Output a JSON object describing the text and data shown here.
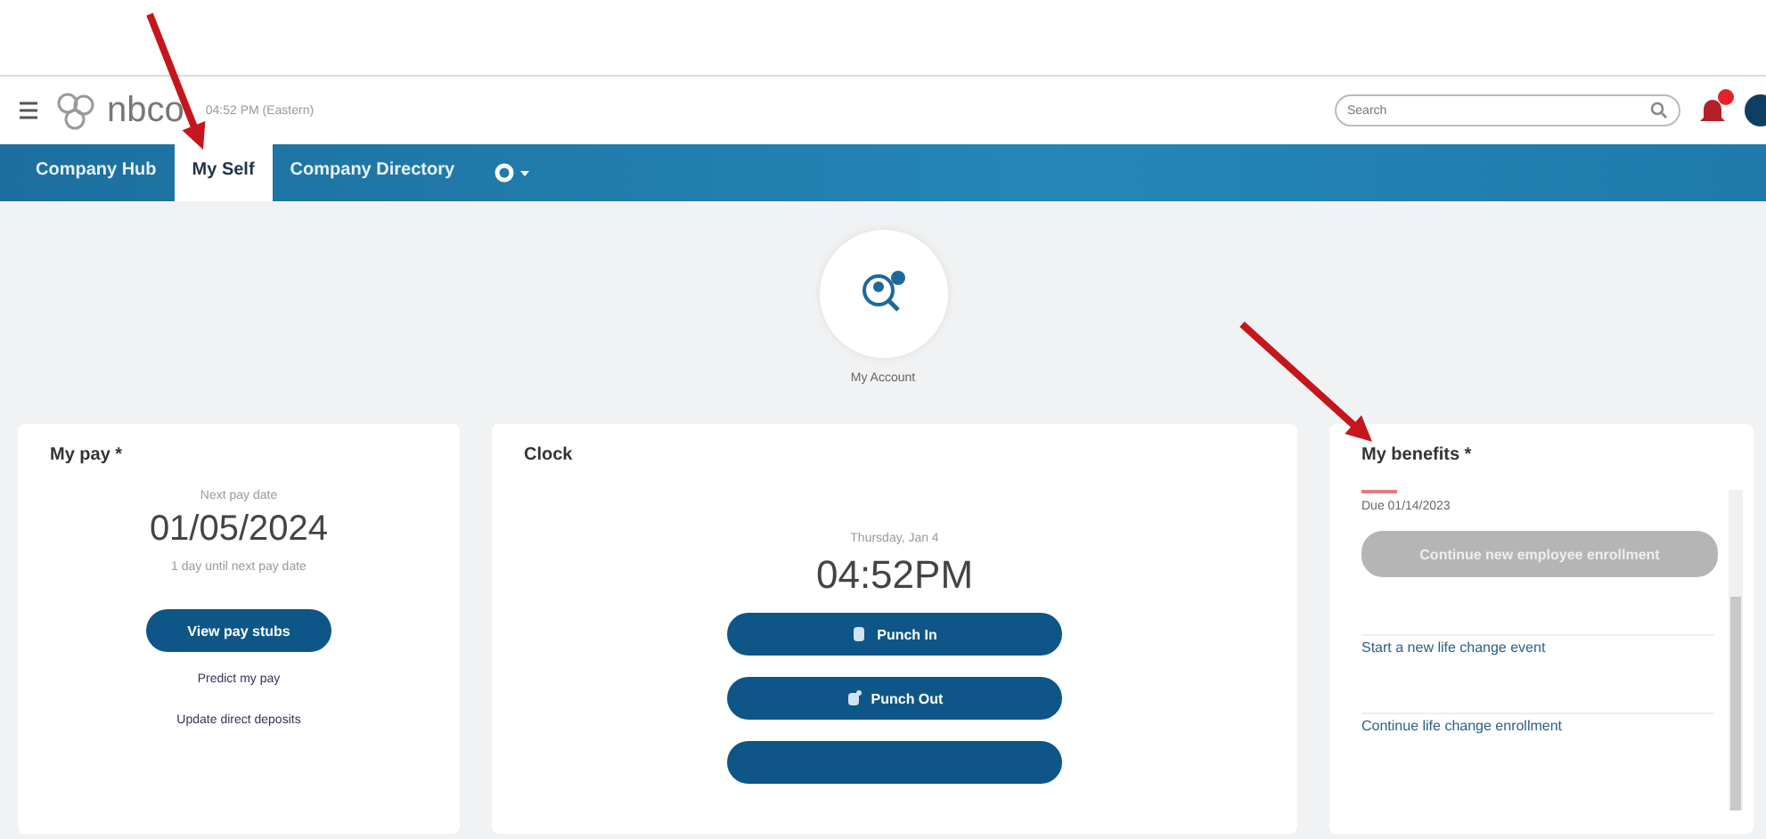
{
  "header": {
    "logo": "nbco",
    "subtitle": "04:52 PM (Eastern)",
    "search": {
      "placeholder": "Search"
    },
    "notifications": {
      "unread": true
    }
  },
  "tabs": [
    {
      "label": "Company Hub",
      "selected": false
    },
    {
      "label": "My Self",
      "selected": true
    },
    {
      "label": "Company Directory",
      "selected": false
    }
  ],
  "account": {
    "label": "My Account"
  },
  "pay": {
    "title": "My pay *",
    "caption": "Next pay date",
    "date": "01/05/2024",
    "note": "1 day until next pay date",
    "button": "View pay stubs",
    "links": [
      "Predict my pay",
      "Update direct deposits"
    ]
  },
  "clock": {
    "title": "Clock",
    "day": "Thursday, Jan 4",
    "time": "04:52PM",
    "buttons": [
      {
        "label": "Punch In",
        "kind": "in"
      },
      {
        "label": "Punch Out",
        "kind": "out"
      },
      {
        "kind": "other"
      }
    ]
  },
  "benefits": {
    "title": "My benefits *",
    "due": "Due 01/14/2023",
    "button": {
      "label": "Continue new employee enrollment",
      "disabled": true
    },
    "links": [
      "Start a new life change event",
      "Continue life change enrollment"
    ]
  },
  "annotations": [
    {
      "kind": "arrow"
    },
    {
      "kind": "arrow"
    }
  ]
}
